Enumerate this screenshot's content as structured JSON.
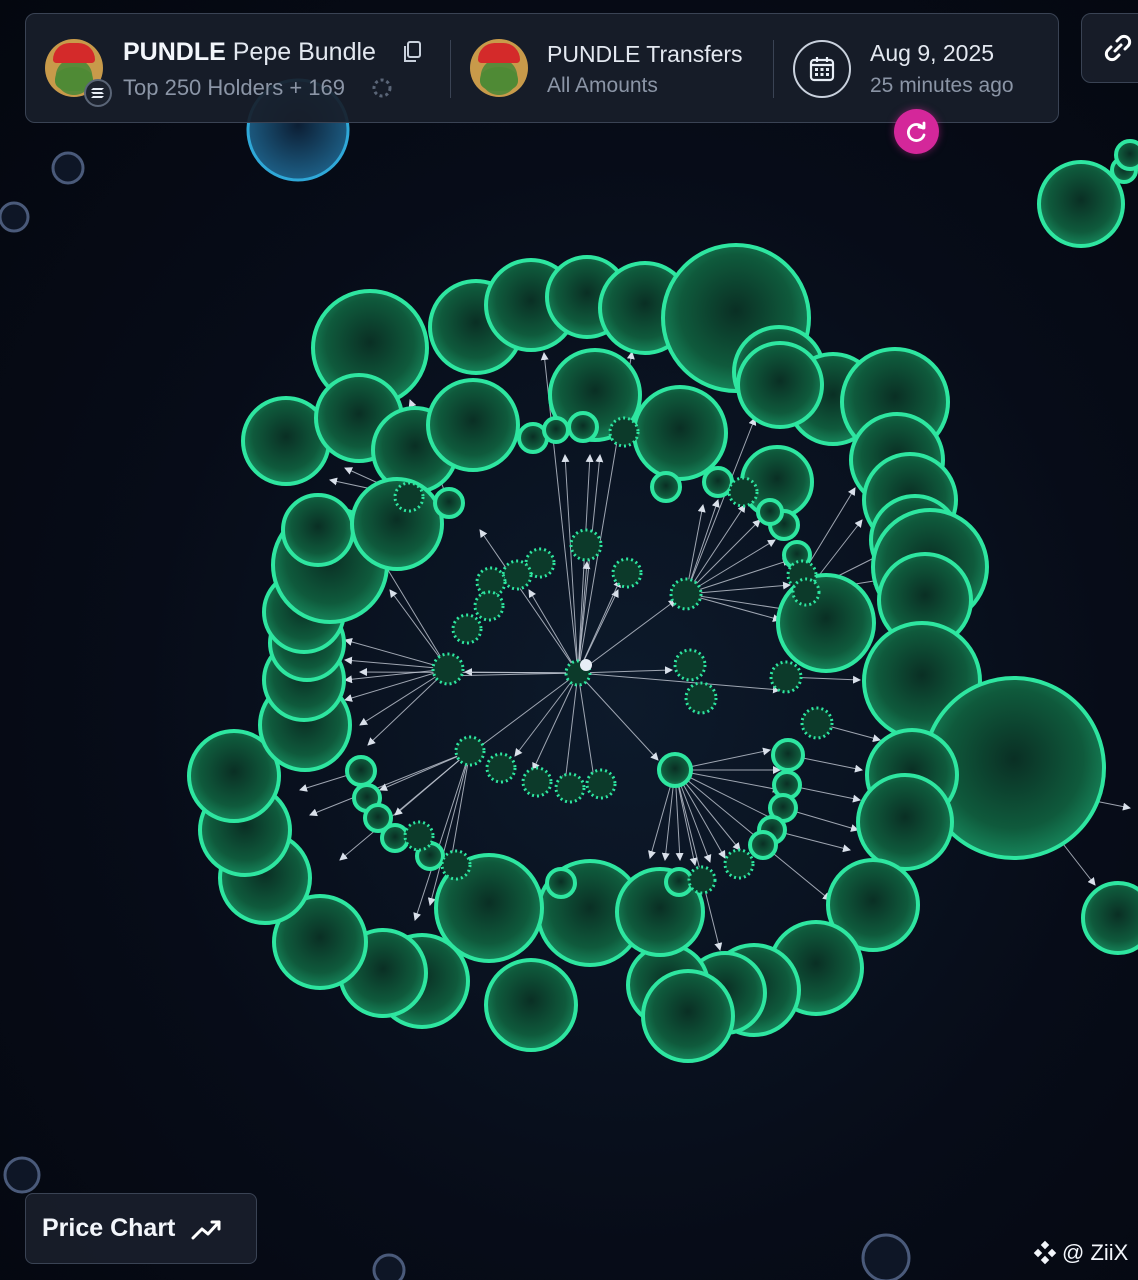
{
  "token": {
    "symbol": "PUNDLE",
    "name": "Pepe Bundle",
    "holders_label": "Top 250 Holders + 169"
  },
  "transfers": {
    "title": "PUNDLE Transfers",
    "subtitle": "All Amounts"
  },
  "snapshot": {
    "date": "Aug 9, 2025",
    "relative": "25 minutes ago"
  },
  "buttons": {
    "price_chart": "Price Chart"
  },
  "watermark": {
    "text": "@ ZiiX"
  },
  "icons": {
    "copy": "copy-icon",
    "chain": "solana-icon",
    "loading": "spinner-icon",
    "calendar": "calendar-icon",
    "refresh": "refresh-icon",
    "link": "link-icon",
    "trend": "trend-up-icon",
    "watermark": "binance-icon"
  },
  "colors": {
    "bubble_fill": "#0f5a3c",
    "bubble_stroke": "#2ee6a0",
    "other_bubble_stroke": "#2fa8d8",
    "refresh_accent": "#d4279a",
    "background": "#060b16"
  }
}
